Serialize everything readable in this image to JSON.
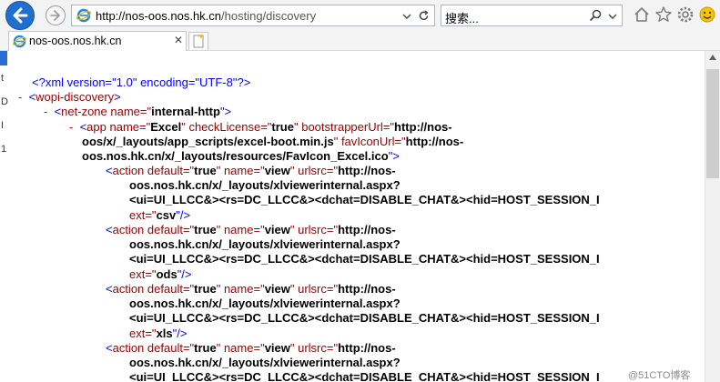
{
  "browser": {
    "url_domain": "http://nos-oos.nos.hk.cn",
    "url_path": "/hosting/discovery",
    "search_placeholder": "搜索...",
    "tab_label": "nos-oos.nos.hk.cn",
    "accent": "#1f6fd1"
  },
  "left_edge_marks": [
    "t",
    "D",
    "I",
    "1"
  ],
  "xml": {
    "line1": {
      "pi": "<?xml version=\"1.0\" encoding=\"UTF-8\"?>"
    },
    "line2": {
      "dash": "-",
      "open": "<",
      "tag": "wopi-discovery",
      "close": ">"
    },
    "line3": {
      "dash": "-",
      "open": "<",
      "tag": "net-zone",
      "attr": " name=\"",
      "val": "internal-http",
      "end": "\">"
    },
    "line4": {
      "dash": "-",
      "open": "<",
      "tag": "app",
      "attr1": " name=\"",
      "val1": "Excel",
      "q1": "\"",
      "attr2": " checkLicense=\"",
      "val2": "true",
      "q2": "\"",
      "attr3": " bootstrapperUrl=\"",
      "val3": "http://nos-"
    },
    "line5": {
      "val": "oos/x/_layouts/app_scripts/excel-boot.min.js",
      "q": "\"",
      "attr": " favIconUrl=\"",
      "val2": "http://nos-"
    },
    "line6": {
      "val": "oos.nos.hk.cn/x/_layouts/resources/FavIcon_Excel.ico",
      "end": "\">"
    },
    "actions": [
      {
        "l1": {
          "open": "<",
          "tag": "action",
          "attr1": " default=\"",
          "val1": "true",
          "q1": "\"",
          "attr2": " name=\"",
          "val2": "view",
          "q2": "\"",
          "attr3": " urlsrc=\"",
          "val3": "http://nos-"
        },
        "l2": "oos.nos.hk.cn/x/_layouts/xlviewerinternal.aspx?",
        "l3": "<ui=UI_LLCC&><rs=DC_LLCC&><dchat=DISABLE_CHAT&><hid=HOST_SESSION_I",
        "l4": {
          "attr": "ext=\"",
          "val": "csv",
          "end": "\"/>"
        }
      },
      {
        "l1": {
          "open": "<",
          "tag": "action",
          "attr1": " default=\"",
          "val1": "true",
          "q1": "\"",
          "attr2": " name=\"",
          "val2": "view",
          "q2": "\"",
          "attr3": " urlsrc=\"",
          "val3": "http://nos-"
        },
        "l2": "oos.nos.hk.cn/x/_layouts/xlviewerinternal.aspx?",
        "l3": "<ui=UI_LLCC&><rs=DC_LLCC&><dchat=DISABLE_CHAT&><hid=HOST_SESSION_I",
        "l4": {
          "attr": "ext=\"",
          "val": "ods",
          "end": "\"/>"
        }
      },
      {
        "l1": {
          "open": "<",
          "tag": "action",
          "attr1": " default=\"",
          "val1": "true",
          "q1": "\"",
          "attr2": " name=\"",
          "val2": "view",
          "q2": "\"",
          "attr3": " urlsrc=\"",
          "val3": "http://nos-"
        },
        "l2": "oos.nos.hk.cn/x/_layouts/xlviewerinternal.aspx?",
        "l3": "<ui=UI_LLCC&><rs=DC_LLCC&><dchat=DISABLE_CHAT&><hid=HOST_SESSION_I",
        "l4": {
          "attr": "ext=\"",
          "val": "xls",
          "end": "\"/>"
        }
      },
      {
        "l1": {
          "open": "<",
          "tag": "action",
          "attr1": " default=\"",
          "val1": "true",
          "q1": "\"",
          "attr2": " name=\"",
          "val2": "view",
          "q2": "\"",
          "attr3": " urlsrc=\"",
          "val3": "http://nos-"
        },
        "l2": "oos.nos.hk.cn/x/_layouts/xlviewerinternal.aspx?",
        "l3": "<ui=UI_LLCC&><rs=DC_LLCC&><dchat=DISABLE_CHAT&><hid=HOST_SESSION_I"
      }
    ]
  },
  "watermark": "@51CTO博客"
}
